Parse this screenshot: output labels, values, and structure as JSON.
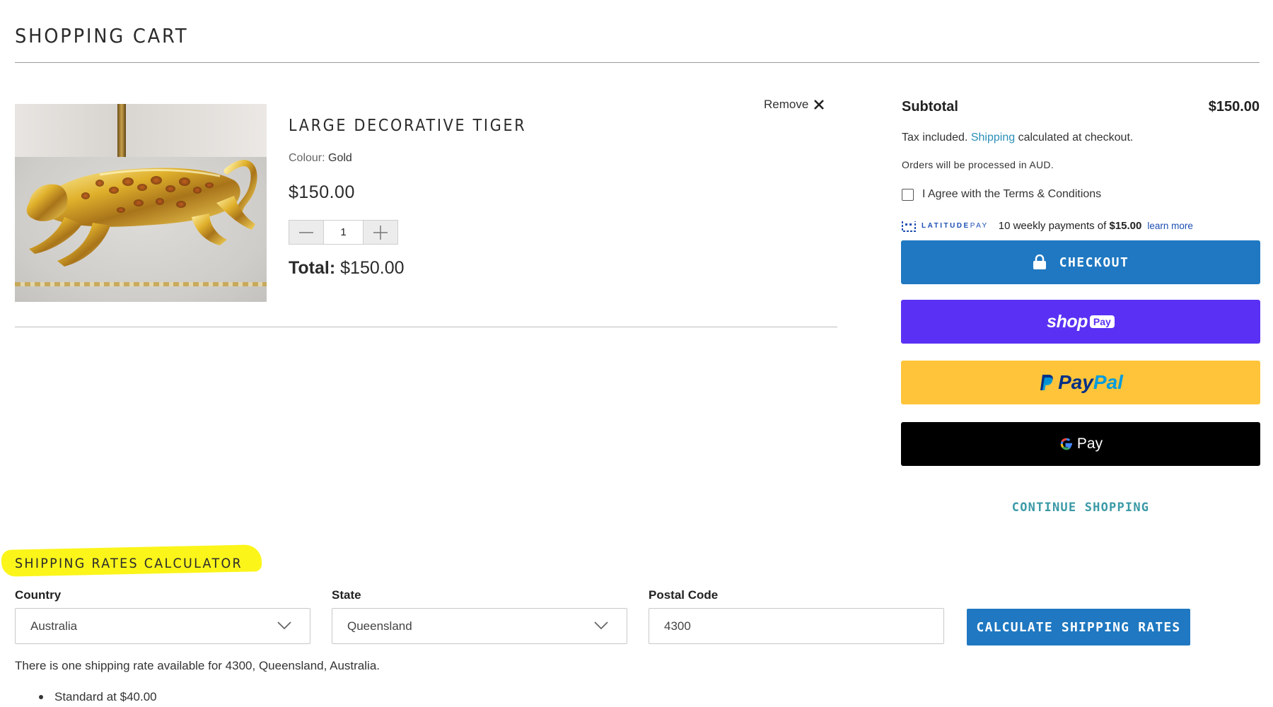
{
  "page": {
    "title": "SHOPPING CART"
  },
  "cart_item": {
    "name": "LARGE DECORATIVE TIGER",
    "colour_label": "Colour:",
    "colour_value": "Gold",
    "price": "$150.00",
    "quantity": "1",
    "total_label": "Total:",
    "total_value": "$150.00",
    "remove_label": "Remove"
  },
  "summary": {
    "subtotal_label": "Subtotal",
    "subtotal_value": "$150.00",
    "tax_prefix": "Tax included.",
    "shipping_link": "Shipping",
    "tax_suffix": "calculated at checkout.",
    "currency_note": "Orders will be processed in AUD.",
    "terms_label": "I Agree with the Terms & Conditions",
    "latitude": {
      "logo_bold": "LATITUDE",
      "logo_thin": "PAY",
      "message_prefix": "10 weekly payments of",
      "amount": "$15.00",
      "learn_more": "learn more"
    },
    "checkout_label": "CHECKOUT",
    "shoppay": {
      "word": "shop",
      "badge": "Pay"
    },
    "paypal": {
      "part1": "Pay",
      "part2": "Pal"
    },
    "gpay_label": "Pay",
    "continue_label": "CONTINUE SHOPPING"
  },
  "shipping_calculator": {
    "title": "SHIPPING RATES CALCULATOR",
    "country_label": "Country",
    "country_value": "Australia",
    "state_label": "State",
    "state_value": "Queensland",
    "postal_label": "Postal Code",
    "postal_value": "4300",
    "button_label": "CALCULATE SHIPPING RATES",
    "result_message": "There is one shipping rate available for 4300, Queensland, Australia.",
    "rates": [
      "Standard at $40.00"
    ]
  },
  "colors": {
    "checkout_blue": "#1f78c1",
    "shoppay_purple": "#5a31f4",
    "paypal_yellow": "#ffc43a",
    "gpay_black": "#000000",
    "link_teal": "#3a9aa6",
    "highlight_yellow": "#fbf51a"
  }
}
